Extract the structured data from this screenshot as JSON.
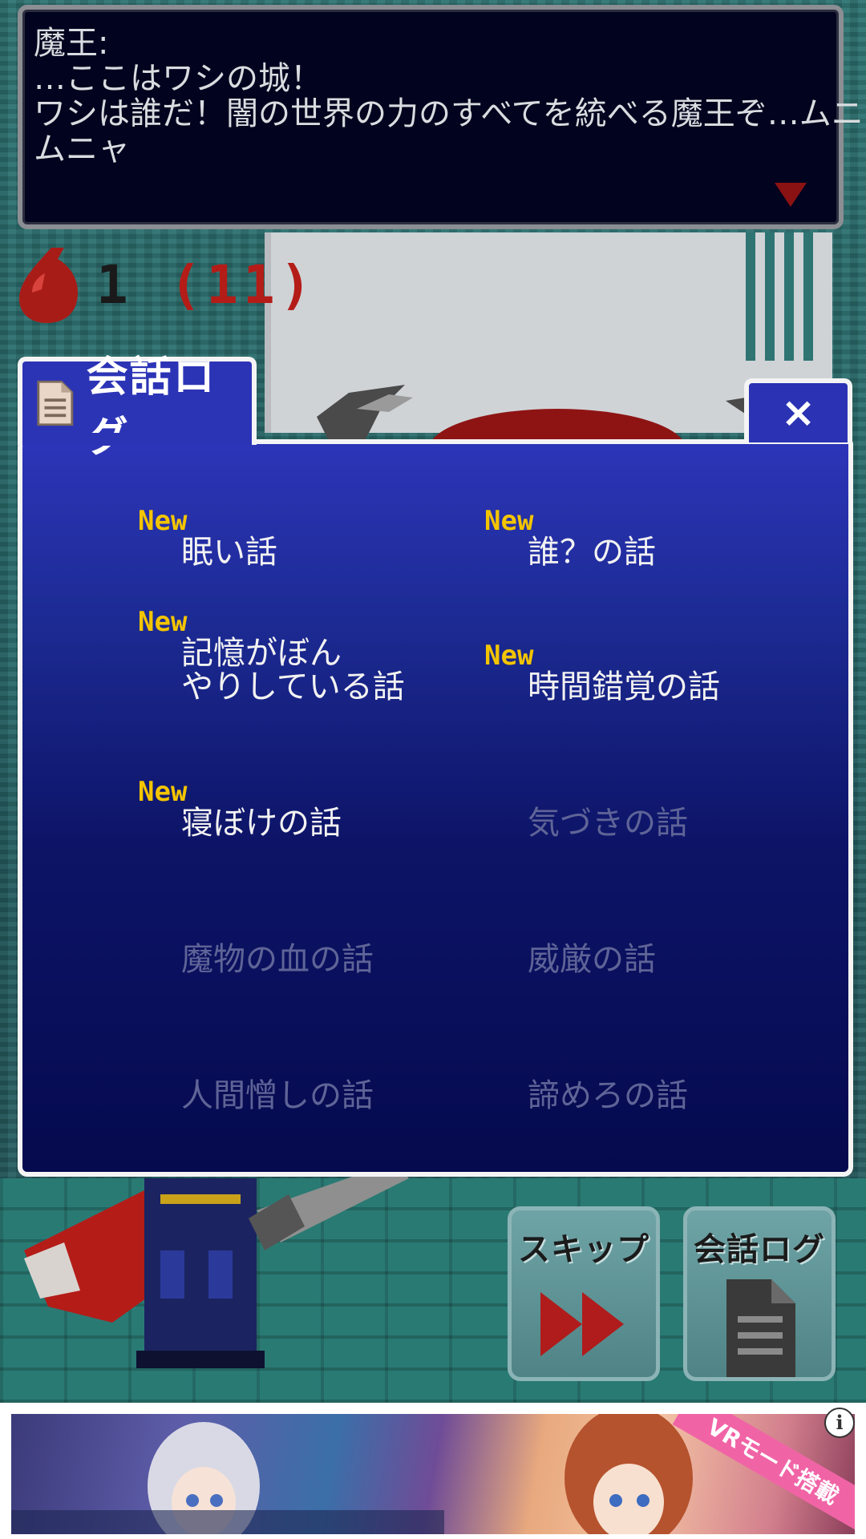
{
  "message": {
    "speaker": "魔王:",
    "lines": [
      "…ここはワシの城！",
      "ワシは誰だ！闇の世界の力のすべてを統べる魔王ぞ…ムニャ",
      "ムニャ"
    ]
  },
  "counter": {
    "value": "1",
    "total": "(11)",
    "icon": "blood-drop-icon"
  },
  "log_panel": {
    "tab_title": "会話ログ",
    "close_label": "×",
    "new_badge": "New",
    "entries": [
      {
        "title": "眠い話",
        "is_new": true,
        "unlocked": true
      },
      {
        "title": "誰？の話",
        "is_new": true,
        "unlocked": true
      },
      {
        "title": "記憶がぼん\nやりしている話",
        "is_new": true,
        "unlocked": true
      },
      {
        "title": "時間錯覚の話",
        "is_new": true,
        "unlocked": true
      },
      {
        "title": "寝ぼけの話",
        "is_new": true,
        "unlocked": true
      },
      {
        "title": "気づきの話",
        "is_new": false,
        "unlocked": false
      },
      {
        "title": "魔物の血の話",
        "is_new": false,
        "unlocked": false
      },
      {
        "title": "威厳の話",
        "is_new": false,
        "unlocked": false
      },
      {
        "title": "人間憎しの話",
        "is_new": false,
        "unlocked": false
      },
      {
        "title": "諦めろの話",
        "is_new": false,
        "unlocked": false
      }
    ]
  },
  "controls": {
    "skip_label": "スキップ",
    "log_label": "会話ログ"
  },
  "ad": {
    "badge": "VRモード搭載",
    "info": "i"
  },
  "colors": {
    "new_badge": "#f3c400",
    "locked_text": "#5f6497",
    "panel_border": "#f4f4f4",
    "panel_top": "#2c35b8",
    "panel_bottom": "#050a4e"
  }
}
